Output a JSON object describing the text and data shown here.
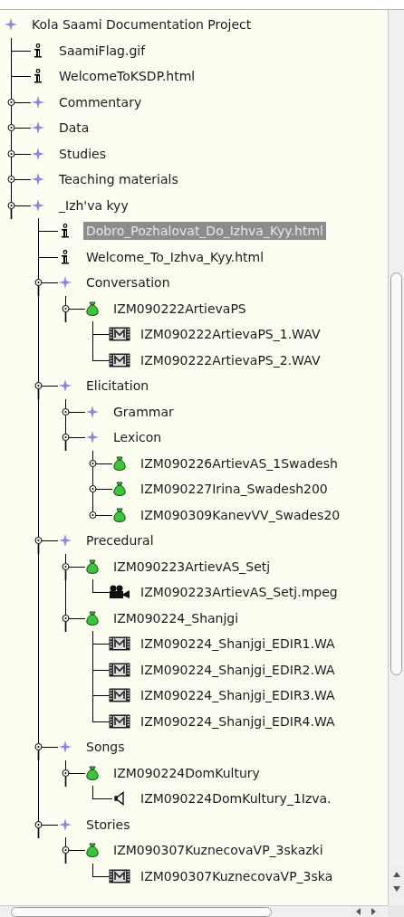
{
  "tree": {
    "label": "Kola Saami Documentation Project",
    "kind": "folder",
    "selected": false,
    "children": [
      {
        "label": "SaamiFlag.gif",
        "kind": "document",
        "selected": false
      },
      {
        "label": "WelcomeToKSDP.html",
        "kind": "document",
        "selected": false
      },
      {
        "label": "Commentary",
        "kind": "folder",
        "selected": false,
        "expanded": false
      },
      {
        "label": "Data",
        "kind": "folder",
        "selected": false,
        "expanded": false
      },
      {
        "label": "Studies",
        "kind": "folder",
        "selected": false,
        "expanded": false
      },
      {
        "label": "Teaching materials",
        "kind": "folder",
        "selected": false,
        "expanded": false
      },
      {
        "label": "_Izh'va kyy",
        "kind": "folder",
        "selected": false,
        "expanded": true,
        "children": [
          {
            "label": "Dobro_Pozhalovat_Do_Izhva_Kyy.html",
            "kind": "document",
            "selected": true
          },
          {
            "label": "Welcome_To_Izhva_Kyy.html",
            "kind": "document",
            "selected": false
          },
          {
            "label": "Conversation",
            "kind": "folder",
            "selected": false,
            "expanded": true,
            "children": [
              {
                "label": "IZM090222ArtievaPS",
                "kind": "session",
                "selected": false,
                "expanded": true,
                "children": [
                  {
                    "label": "IZM090222ArtievaPS_1.WAV",
                    "kind": "film",
                    "selected": false
                  },
                  {
                    "label": "IZM090222ArtievaPS_2.WAV",
                    "kind": "film",
                    "selected": false
                  }
                ]
              }
            ]
          },
          {
            "label": "Elicitation",
            "kind": "folder",
            "selected": false,
            "expanded": true,
            "children": [
              {
                "label": "Grammar",
                "kind": "folder",
                "selected": false,
                "expanded": false
              },
              {
                "label": "Lexicon",
                "kind": "folder",
                "selected": false,
                "expanded": true,
                "children": [
                  {
                    "label": "IZM090226ArtievAS_1Swadesh",
                    "kind": "session",
                    "selected": false,
                    "expanded": false
                  },
                  {
                    "label": "IZM090227Irina_Swadesh200",
                    "kind": "session",
                    "selected": false,
                    "expanded": false
                  },
                  {
                    "label": "IZM090309KanevVV_Swades20",
                    "kind": "session",
                    "selected": false,
                    "expanded": false
                  }
                ]
              }
            ]
          },
          {
            "label": "Precedural",
            "kind": "folder",
            "selected": false,
            "expanded": true,
            "children": [
              {
                "label": "IZM090223ArtievAS_Setj",
                "kind": "session",
                "selected": false,
                "expanded": true,
                "children": [
                  {
                    "label": "IZM090223ArtievAS_Setj.mpeg",
                    "kind": "video",
                    "selected": false
                  }
                ]
              },
              {
                "label": "IZM090224_Shanjgi",
                "kind": "session",
                "selected": false,
                "expanded": true,
                "children": [
                  {
                    "label": "IZM090224_Shanjgi_EDIR1.WA",
                    "kind": "film",
                    "selected": false
                  },
                  {
                    "label": "IZM090224_Shanjgi_EDIR2.WA",
                    "kind": "film",
                    "selected": false
                  },
                  {
                    "label": "IZM090224_Shanjgi_EDIR3.WA",
                    "kind": "film",
                    "selected": false
                  },
                  {
                    "label": "IZM090224_Shanjgi_EDIR4.WA",
                    "kind": "film",
                    "selected": false
                  }
                ]
              }
            ]
          },
          {
            "label": "Songs",
            "kind": "folder",
            "selected": false,
            "expanded": true,
            "children": [
              {
                "label": "IZM090224DomKultury",
                "kind": "session",
                "selected": false,
                "expanded": true,
                "children": [
                  {
                    "label": "IZM090224DomKultury_1Izva.",
                    "kind": "sound",
                    "selected": false
                  }
                ]
              }
            ]
          },
          {
            "label": "Stories",
            "kind": "folder",
            "selected": false,
            "expanded": true,
            "children": [
              {
                "label": "IZM090307KuznecovaVP_3skazki",
                "kind": "session",
                "selected": false,
                "expanded": true,
                "children": [
                  {
                    "label": "IZM090307KuznecovaVP_3ska",
                    "kind": "film",
                    "selected": false
                  }
                ]
              }
            ]
          }
        ]
      }
    ]
  }
}
